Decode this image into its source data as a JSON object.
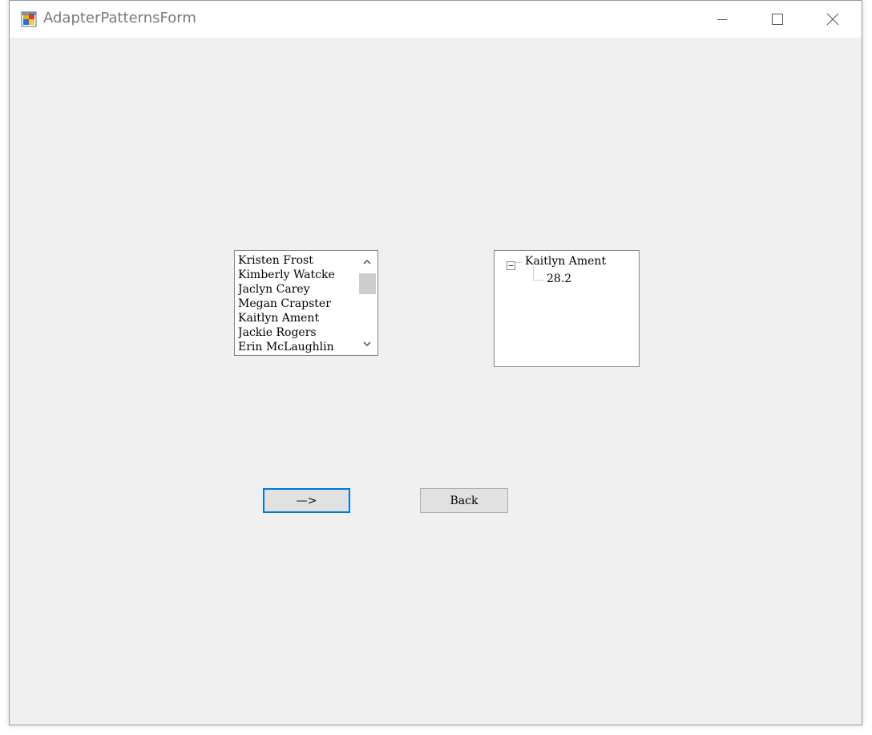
{
  "window": {
    "title": "AdapterPatternsForm",
    "icon": "winforms-app-icon",
    "controls": {
      "minimize_icon": "minimize-icon",
      "maximize_icon": "maximize-icon",
      "close_icon": "close-icon"
    }
  },
  "listbox": {
    "items": [
      "Kristen Frost",
      "Kimberly Watcke",
      "Jaclyn Carey",
      "Megan Crapster",
      "Kaitlyn Ament",
      "Jackie Rogers",
      "Erin McLaughlin"
    ],
    "scroll_up_icon": "chevron-up-icon",
    "scroll_down_icon": "chevron-down-icon"
  },
  "treeview": {
    "root": {
      "label": "Kaitlyn Ament",
      "expanded": true,
      "expander_icon": "minus-box-icon",
      "children": [
        {
          "label": "28.2"
        }
      ]
    }
  },
  "buttons": {
    "next_label": "—>",
    "back_label": "Back"
  },
  "colors": {
    "window_bg": "#f0f0f0",
    "titlebar_bg": "#ffffff",
    "title_text": "#7a7a7a",
    "focus_accent": "#0078d7",
    "button_bg": "#e1e1e1",
    "scroll_thumb": "#cdcdcd"
  }
}
